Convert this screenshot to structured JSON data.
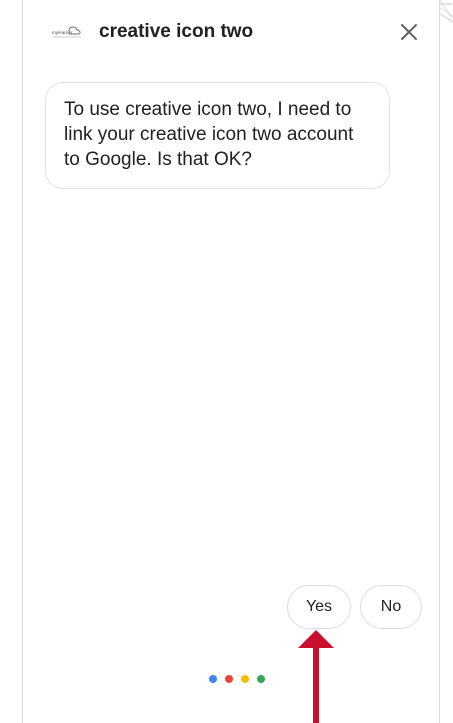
{
  "header": {
    "logo_text": "mylearner",
    "title": "creative icon two",
    "close_icon": "close-icon"
  },
  "message": {
    "text": "To use creative icon two, I need to link your creative icon two account to Google. Is that OK?"
  },
  "suggestions": {
    "yes_label": "Yes",
    "no_label": "No"
  },
  "assistant_dots": {
    "colors": [
      "#4285F4",
      "#EA4335",
      "#FBBC05",
      "#34A853"
    ]
  },
  "annotation": {
    "arrow_color": "#C8102E"
  }
}
